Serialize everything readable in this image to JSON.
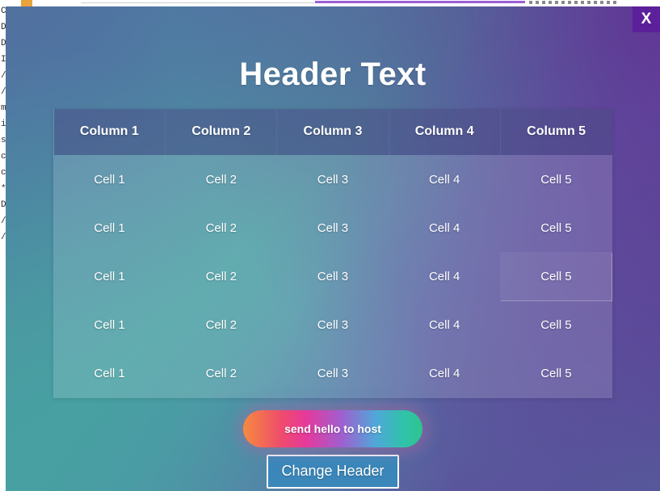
{
  "background_page": {
    "lines": [
      "C",
      "D",
      "D",
      "I",
      "/",
      "/",
      "m",
      "i",
      "s",
      "c",
      "c",
      "*",
      "D",
      "/",
      "/"
    ]
  },
  "modal": {
    "close_button_label": "X",
    "header_text": "Header Text",
    "table": {
      "columns": [
        "Column 1",
        "Column 2",
        "Column 3",
        "Column 4",
        "Column 5"
      ],
      "rows": [
        [
          "Cell 1",
          "Cell 2",
          "Cell 3",
          "Cell 4",
          "Cell 5"
        ],
        [
          "Cell 1",
          "Cell 2",
          "Cell 3",
          "Cell 4",
          "Cell 5"
        ],
        [
          "Cell 1",
          "Cell 2",
          "Cell 3",
          "Cell 4",
          "Cell 5"
        ],
        [
          "Cell 1",
          "Cell 2",
          "Cell 3",
          "Cell 4",
          "Cell 5"
        ],
        [
          "Cell 1",
          "Cell 2",
          "Cell 3",
          "Cell 4",
          "Cell 5"
        ]
      ],
      "highlighted_cell": {
        "row": 2,
        "col": 4
      }
    },
    "buttons": {
      "hello_label": "send hello to host",
      "change_header_label": "Change Header"
    }
  },
  "colors": {
    "close_button_bg": "#5b209a",
    "gradient_top_left": "#51719f",
    "gradient_bottom_left": "#48a0a2",
    "gradient_top_right": "#613093",
    "gradient_bottom_right": "#555d9c",
    "table_header_bg": "#454a85",
    "change_header_bg": "#3b87ba"
  }
}
